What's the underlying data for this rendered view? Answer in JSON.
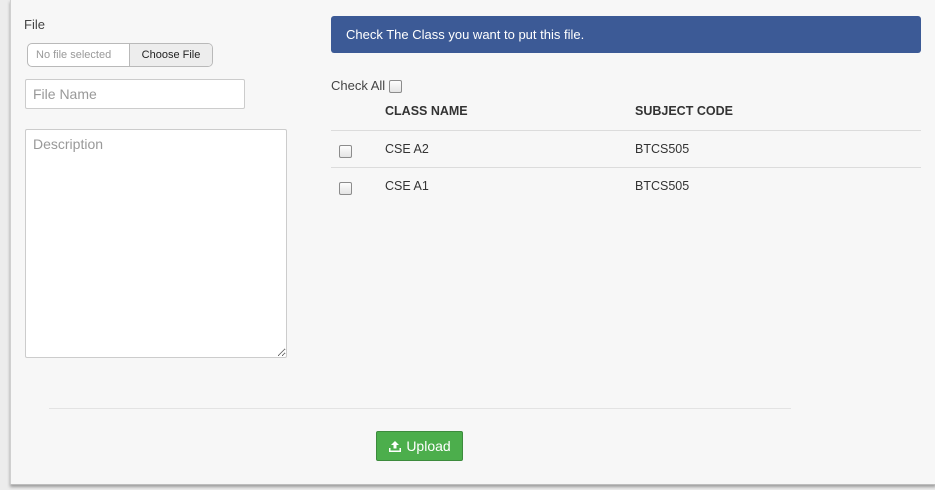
{
  "form": {
    "file_label": "File",
    "file_status": "No file selected",
    "choose_label": "Choose File",
    "file_name_placeholder": "File Name",
    "description_placeholder": "Description"
  },
  "classes": {
    "banner_text": "Check The Class you want to put this file.",
    "check_all_label": "Check All",
    "columns": [
      "CLASS NAME",
      "SUBJECT CODE"
    ],
    "rows": [
      {
        "class_name": "CSE A2",
        "subject_code": "BTCS505"
      },
      {
        "class_name": "CSE A1",
        "subject_code": "BTCS505"
      }
    ]
  },
  "actions": {
    "upload_label": "Upload",
    "upload_icon": "upload-icon",
    "accent_color": "#4cae4c",
    "banner_color": "#3c5a96"
  }
}
